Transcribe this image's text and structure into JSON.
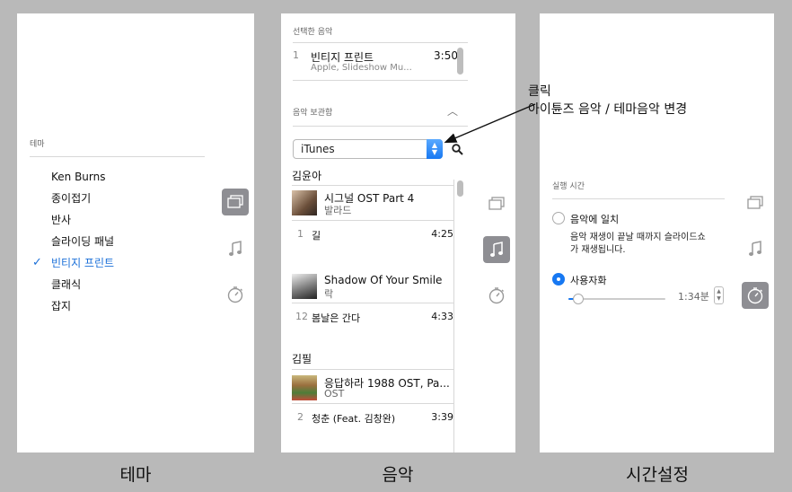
{
  "theme_panel": {
    "section_label": "테마",
    "items": [
      "Ken Burns",
      "종이접기",
      "반사",
      "슬라이딩 패널",
      "빈티지 프린트",
      "클래식",
      "잡지"
    ],
    "selected_index": 4,
    "caption": "테마"
  },
  "music_panel": {
    "selected_label": "선택한 음악",
    "selected_track": {
      "num": "1",
      "title": "빈티지 프린트",
      "subtitle": "Apple, Slideshow Mu...",
      "duration": "3:50"
    },
    "library_label": "음악 보관함",
    "source": "iTunes",
    "groups": [
      {
        "artist": "김윤아",
        "albums": [
          {
            "title": "시그널 OST Part 4",
            "subtitle": "발라드",
            "track": {
              "num": "1",
              "title": "길",
              "duration": "4:25"
            }
          },
          {
            "title": "Shadow Of Your Smile",
            "subtitle": "락",
            "track": {
              "num": "12",
              "title": "봄날은 간다",
              "duration": "4:33"
            }
          }
        ]
      },
      {
        "artist": "김필",
        "albums": [
          {
            "title": "응답하라 1988 OST, Pa...",
            "subtitle": "OST",
            "track": {
              "num": "2",
              "title": "청춘 (Feat. 김창완)",
              "duration": "3:39"
            }
          }
        ]
      }
    ],
    "caption": "음악"
  },
  "time_panel": {
    "section_label": "실행 시간",
    "option1_label": "음악에 일치",
    "option1_desc_line1": "음악 재생이 끝날 때까지 슬라이드쇼",
    "option1_desc_line2": "가 재생됩니다.",
    "option2_label": "사용자화",
    "duration_value": "1:34분",
    "slider_position": 0.05,
    "caption": "시간설정"
  },
  "annotation": {
    "line1": "클릭",
    "line2": "아이튠즈 음악 / 테마음악 변경"
  },
  "icons": [
    "slides-icon",
    "music-note-icon",
    "stopwatch-icon"
  ]
}
